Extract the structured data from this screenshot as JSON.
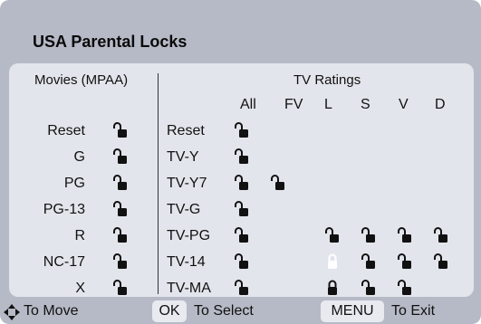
{
  "title": "USA Parental Locks",
  "movies": {
    "header": "Movies (MPAA)",
    "items": [
      {
        "label": "Reset",
        "lock": "open"
      },
      {
        "label": "G",
        "lock": "open"
      },
      {
        "label": "PG",
        "lock": "open"
      },
      {
        "label": "PG-13",
        "lock": "open"
      },
      {
        "label": "R",
        "lock": "open"
      },
      {
        "label": "NC-17",
        "lock": "open"
      },
      {
        "label": "X",
        "lock": "open"
      }
    ]
  },
  "tv": {
    "header": "TV Ratings",
    "columns": [
      "All",
      "FV",
      "L",
      "S",
      "V",
      "D"
    ],
    "rows": [
      {
        "label": "Reset",
        "locks": [
          "open",
          null,
          null,
          null,
          null,
          null
        ]
      },
      {
        "label": "TV-Y",
        "locks": [
          "open",
          null,
          null,
          null,
          null,
          null
        ]
      },
      {
        "label": "TV-Y7",
        "locks": [
          "open",
          "open",
          null,
          null,
          null,
          null
        ]
      },
      {
        "label": "TV-G",
        "locks": [
          "open",
          null,
          null,
          null,
          null,
          null
        ]
      },
      {
        "label": "TV-PG",
        "locks": [
          "open",
          null,
          "open",
          "open",
          "open",
          "open"
        ]
      },
      {
        "label": "TV-14",
        "locks": [
          "open",
          null,
          "closed-selected",
          "open",
          "open",
          "open"
        ]
      },
      {
        "label": "TV-MA",
        "locks": [
          "open",
          null,
          "closed",
          "open",
          "open",
          null
        ]
      }
    ]
  },
  "footer": {
    "move_icon": "four-way-arrow-icon",
    "move_label": "To Move",
    "ok_key": "OK",
    "select_label": "To Select",
    "menu_key": "MENU",
    "exit_label": "To Exit"
  },
  "colors": {
    "screen_bg": "#b6bac6",
    "panel_bg": "#e3e5ec",
    "lock": "#111111",
    "lock_selected": "#ffffff"
  }
}
